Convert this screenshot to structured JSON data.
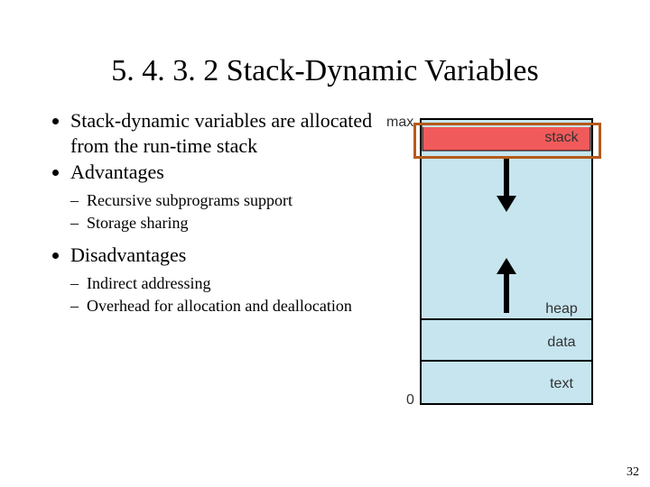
{
  "slide": {
    "title": "5. 4. 3. 2 Stack-Dynamic Variables",
    "page_number": "32",
    "bullets": {
      "b1": "Stack-dynamic variables are allocated from the run-time stack",
      "b2": "Advantages",
      "b2_sub": {
        "s1": "Recursive subprograms support",
        "s2": "Storage sharing"
      },
      "b3": "Disadvantages",
      "b3_sub": {
        "s1": "Indirect addressing",
        "s2": "Overhead for allocation and deallocation"
      }
    }
  },
  "memory_diagram": {
    "top_label": "max",
    "bottom_label": "0",
    "regions": {
      "stack": "stack",
      "heap": "heap",
      "data": "data",
      "text": "text"
    }
  }
}
